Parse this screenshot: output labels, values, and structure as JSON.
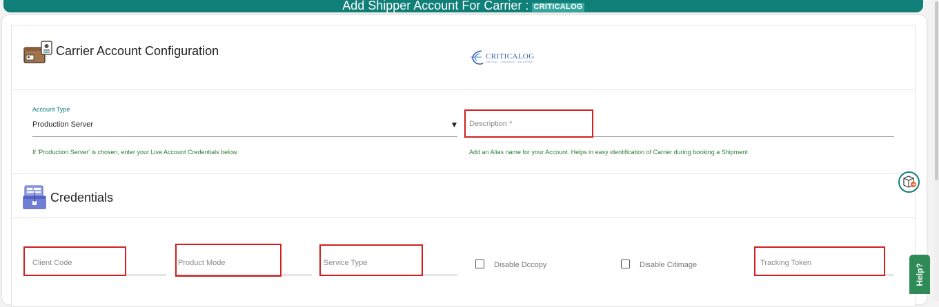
{
  "header": {
    "title": "Add Shipper Account For Carrier :",
    "carrier_name": "CRITICALOG"
  },
  "config_section": {
    "title": "Carrier Account Configuration",
    "icon": "box-card-icon",
    "logo_text": "CRITICALOG",
    "logo_tagline": "CRITICAL · LOGISTICS · SOLUTIONS"
  },
  "account_type": {
    "label": "Account Type",
    "value": "Production Server",
    "hint": "If 'Production Server' is chosen, enter your Live Account Credentials below"
  },
  "description": {
    "placeholder": "Description *",
    "hint": "Add an Alias name for your Account. Helps in easy identification of Carrier during booking a Shipment"
  },
  "credentials_section": {
    "title": "Credentials",
    "icon": "credentials-box-icon"
  },
  "fields": {
    "client_code": "Client Code",
    "product_mode": "Product Mode",
    "service_type": "Service Type",
    "tracking_token": "Tracking Token"
  },
  "checkboxes": {
    "disable_dccopy": "Disable Dccopy",
    "disable_citimage": "Disable Citimage"
  },
  "help": {
    "label": "Help?"
  },
  "colors": {
    "header": "#0f7f77",
    "highlight_box": "#d11f1f",
    "hint_text": "#2e7d32",
    "help_tab": "#2e8b57"
  }
}
